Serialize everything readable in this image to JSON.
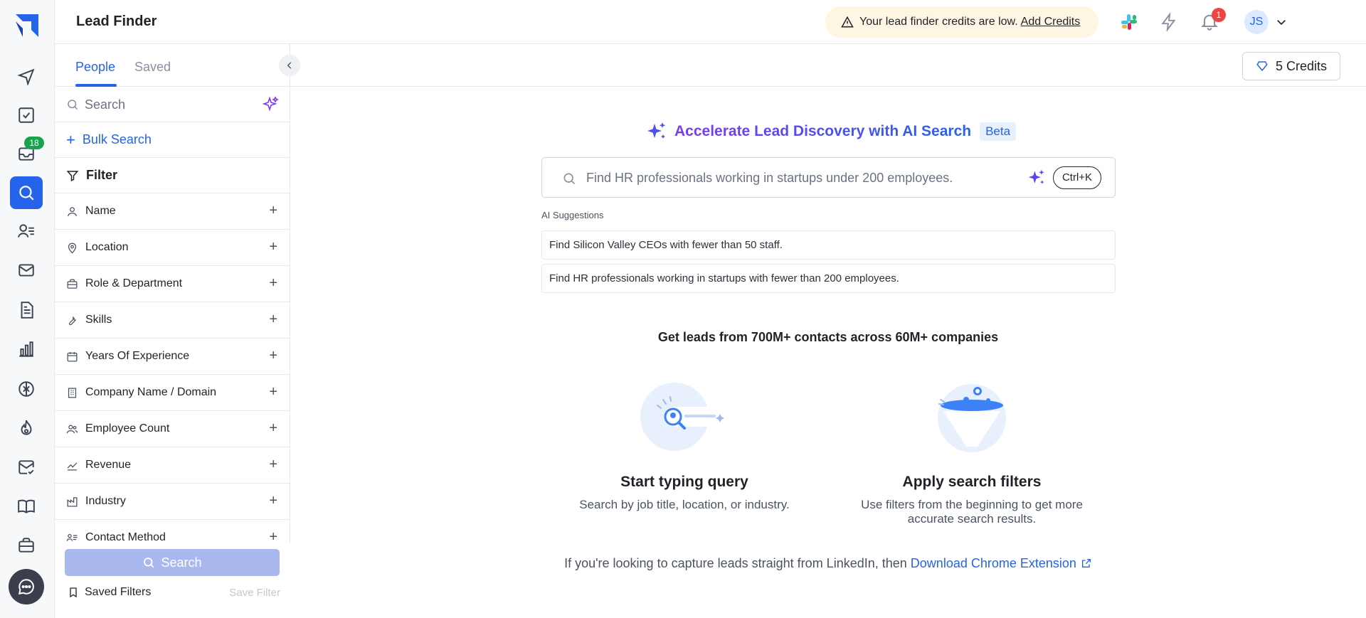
{
  "app": {
    "title": "Lead Finder",
    "rail_badge": "18"
  },
  "topbar": {
    "warning_text": "Your lead finder credits are low.",
    "add_credits": "Add Credits",
    "notification_count": "1",
    "avatar_initials": "JS"
  },
  "panel": {
    "tabs": [
      "People",
      "Saved"
    ],
    "search_placeholder": "Search",
    "bulk_search": "Bulk Search",
    "filter_title": "Filter",
    "filters": [
      {
        "label": "Name",
        "icon": "person-icon"
      },
      {
        "label": "Location",
        "icon": "location-pin-icon"
      },
      {
        "label": "Role & Department",
        "icon": "briefcase-icon"
      },
      {
        "label": "Skills",
        "icon": "wrench-icon"
      },
      {
        "label": "Years Of Experience",
        "icon": "calendar-icon"
      },
      {
        "label": "Company Name / Domain",
        "icon": "building-icon"
      },
      {
        "label": "Employee Count",
        "icon": "users-icon"
      },
      {
        "label": "Revenue",
        "icon": "trend-icon"
      },
      {
        "label": "Industry",
        "icon": "factory-icon"
      },
      {
        "label": "Contact Method",
        "icon": "contact-list-icon"
      }
    ],
    "search_button": "Search",
    "saved_filters": "Saved Filters",
    "save_filter": "Save Filter"
  },
  "main": {
    "credits_button": "5 Credits",
    "headline": "Accelerate Lead Discovery with AI Search",
    "beta": "Beta",
    "ai_placeholder": "Find HR professionals working in startups under 200 employees.",
    "shortcut": "Ctrl+K",
    "suggestions_title": "AI Suggestions",
    "suggestions": [
      "Find Silicon Valley CEOs with fewer than 50 staff.",
      "Find HR professionals working in startups with fewer than 200 employees."
    ],
    "leads_line": "Get leads from 700M+ contacts across 60M+ companies",
    "cards": [
      {
        "title": "Start typing query",
        "desc": "Search by job title, location, or industry."
      },
      {
        "title": "Apply search filters",
        "desc": "Use filters from the beginning to get more accurate search results."
      }
    ],
    "chrome_text": "If you're looking to capture leads straight from LinkedIn, then",
    "chrome_link": "Download Chrome Extension"
  },
  "colors": {
    "accent": "#2563eb",
    "badge_green": "#16a34a",
    "badge_red": "#ef4444",
    "warning_bg": "#fdf6e3"
  }
}
